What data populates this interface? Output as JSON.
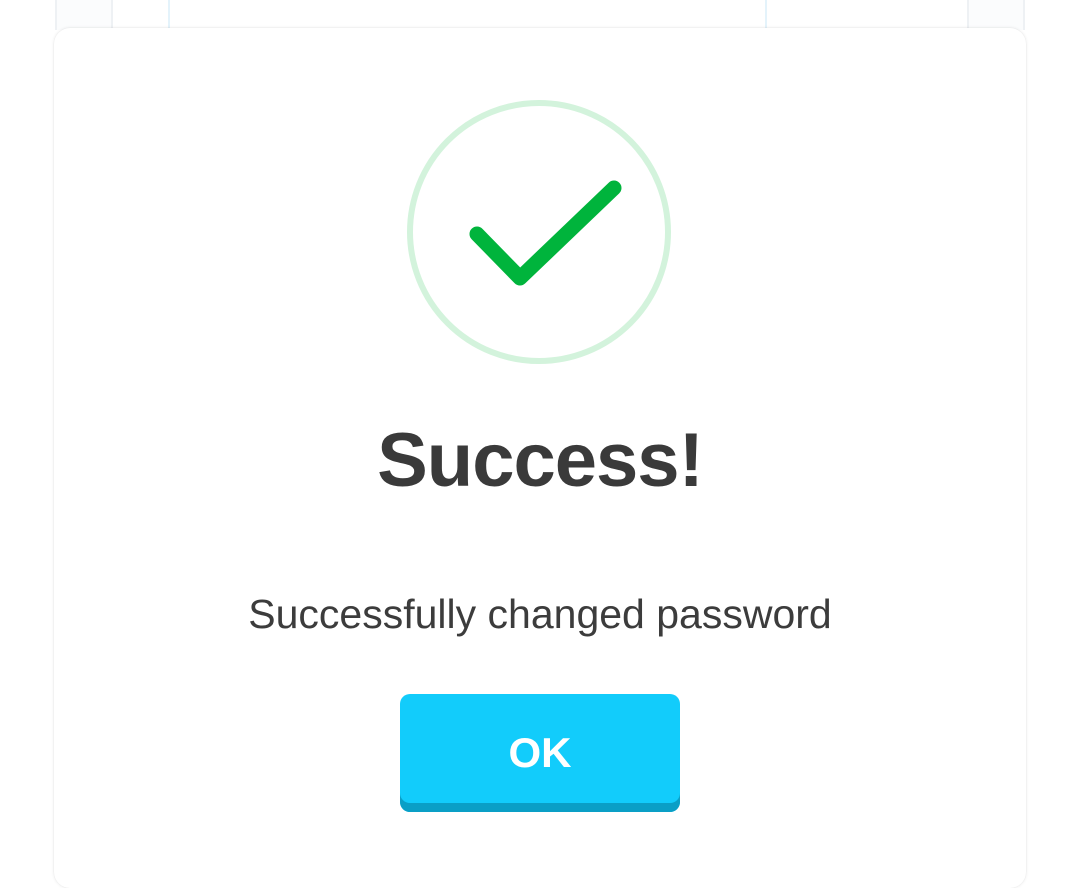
{
  "dialog": {
    "title": "Success!",
    "message": "Successfully changed password",
    "ok_label": "OK",
    "icon": "checkmark-icon"
  },
  "colors": {
    "check_stroke": "#00b43c",
    "ring": "#d3f3dc",
    "button": "#12ccfb",
    "button_shadow": "#0a9fc6",
    "title_text": "#3a3a3a",
    "message_text": "#3c3c3c"
  }
}
